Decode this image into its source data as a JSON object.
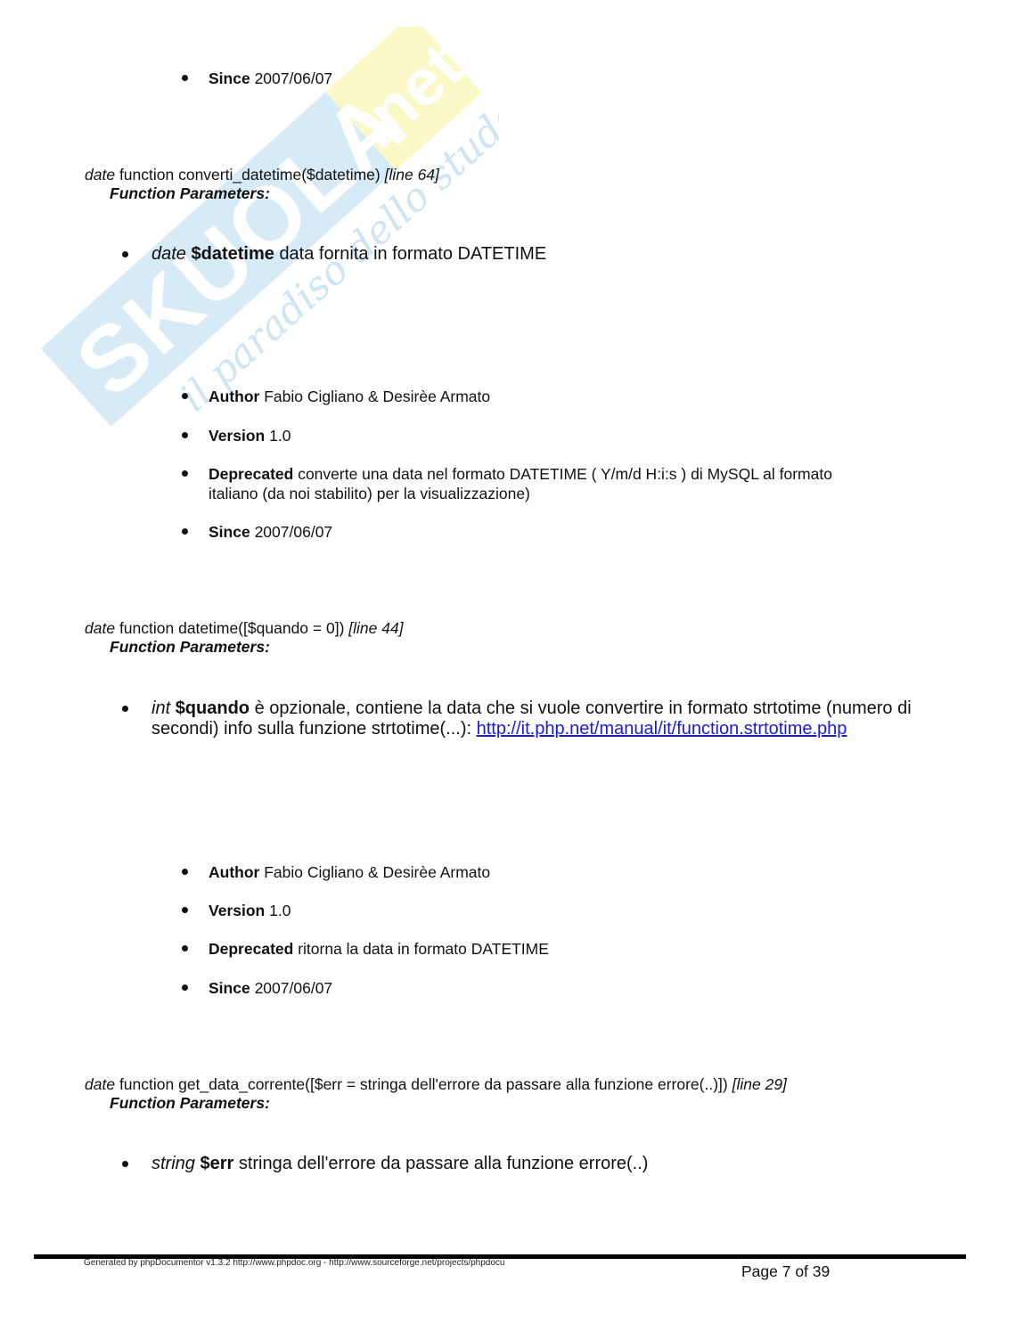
{
  "watermark": {
    "brand": "SKUOLA",
    "brand_suffix": ".net",
    "tagline": "il paradiso dello studente",
    "colors": {
      "band": "#d6eaf8",
      "suffix": "#fbf8c8",
      "tagline": "#cfe5f4"
    }
  },
  "top_section": {
    "tags": [
      {
        "label": "Since",
        "value": "2007/06/07"
      }
    ]
  },
  "functions": [
    {
      "return_type": "date",
      "signature": "function converti_datetime($datetime)",
      "line_ref": "[line 64]",
      "params_heading": "Function Parameters:",
      "params": [
        {
          "type": "date",
          "name": "$datetime",
          "description": "data fornita in formato DATETIME"
        }
      ],
      "tags": [
        {
          "label": "Author",
          "value": "Fabio Cigliano & Desirèe Armato"
        },
        {
          "label": "Version",
          "value": "1.0"
        },
        {
          "label": "Deprecated",
          "value": "converte una data nel formato DATETIME ( Y/m/d H:i:s ) di MySQL al formato",
          "value_line2": "italiano (da noi stabilito) per la visualizzazione)"
        },
        {
          "label": "Since",
          "value": "2007/06/07"
        }
      ]
    },
    {
      "return_type": "date",
      "signature": "function datetime([$quando = 0])",
      "line_ref": "[line 44]",
      "params_heading": "Function Parameters:",
      "params": [
        {
          "type": "int",
          "name": "$quando",
          "description": "è opzionale, contiene la data che si vuole convertire in formato strtotime (numero di",
          "description_line2": "secondi) info sulla funzione strtotime(...): ",
          "link": "http://it.php.net/manual/it/function.strtotime.php"
        }
      ],
      "tags": [
        {
          "label": "Author",
          "value": "Fabio Cigliano & Desirèe Armato"
        },
        {
          "label": "Version",
          "value": "1.0"
        },
        {
          "label": "Deprecated",
          "value": "ritorna la data in formato DATETIME"
        },
        {
          "label": "Since",
          "value": "2007/06/07"
        }
      ]
    },
    {
      "return_type": "date",
      "signature": "function get_data_corrente([$err = stringa dell'errore da passare alla funzione errore(..)])",
      "line_ref": "[line 29]",
      "params_heading": "Function Parameters:",
      "params": [
        {
          "type": "string",
          "name": "$err",
          "description": "stringa dell'errore da passare alla funzione errore(..)"
        }
      ]
    }
  ],
  "footer": {
    "generator": "Generated by phpDocumentor v1.3.2 http://www.phpdoc.org - http://www.sourceforge.net/projects/phpdocu",
    "page": "Page 7 of 39"
  }
}
